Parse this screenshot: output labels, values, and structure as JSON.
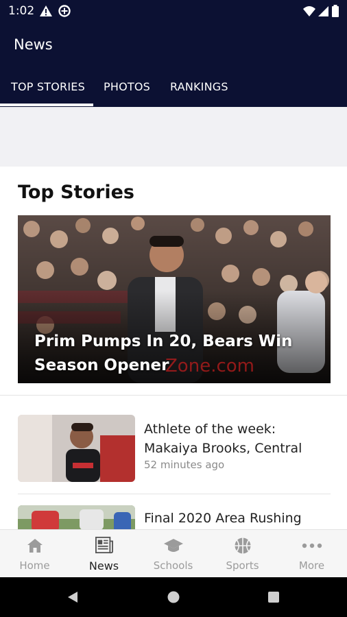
{
  "status_bar": {
    "time": "1:02",
    "icons": [
      "warning-icon",
      "data-saver-icon",
      "wifi-icon",
      "signal-icon",
      "battery-icon"
    ]
  },
  "app_bar": {
    "title": "News",
    "tabs": [
      {
        "label": "TOP STORIES",
        "active": true
      },
      {
        "label": "PHOTOS",
        "active": false
      },
      {
        "label": "RANKINGS",
        "active": false
      }
    ]
  },
  "main": {
    "section_title": "Top Stories",
    "hero": {
      "headline": "Prim Pumps In 20, Bears Win Season Opener",
      "watermark": "Zone.com"
    },
    "stories": [
      {
        "title": "Athlete of the week: Makaiya Brooks, Central",
        "time": "52 minutes ago"
      },
      {
        "title": "Final 2020 Area Rushing",
        "time": ""
      }
    ]
  },
  "bottom_nav": {
    "items": [
      {
        "label": "Home",
        "icon": "home-icon",
        "active": false
      },
      {
        "label": "News",
        "icon": "newspaper-icon",
        "active": true
      },
      {
        "label": "Schools",
        "icon": "graduation-cap-icon",
        "active": false
      },
      {
        "label": "Sports",
        "icon": "basketball-icon",
        "active": false
      },
      {
        "label": "More",
        "icon": "more-dots-icon",
        "active": false
      }
    ]
  },
  "colors": {
    "header_bg": "#0c1133",
    "inactive_nav": "#9b9b9b",
    "active_nav": "#222222"
  }
}
